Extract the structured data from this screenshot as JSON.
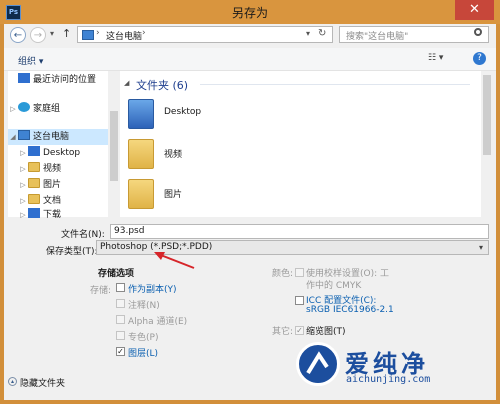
{
  "window": {
    "app_icon": "Ps",
    "title": "另存为",
    "close_glyph": "✕"
  },
  "address": {
    "back_glyph": "←",
    "forward_glyph": "→",
    "recent_glyph": "▾",
    "up_glyph": "↑",
    "path_sep": "›",
    "location": "这台电脑",
    "refresh_glyph": "↻",
    "search_placeholder": "搜索\"这台电脑\""
  },
  "toolbar": {
    "organize_label": "组织 ▾",
    "view_glyph": "☷ ▾",
    "help_glyph": "?"
  },
  "nav": {
    "items": [
      {
        "label": "最近访问的位置"
      },
      {
        "label": "家庭组"
      },
      {
        "label": "这台电脑"
      },
      {
        "label": "Desktop"
      },
      {
        "label": "视频"
      },
      {
        "label": "图片"
      },
      {
        "label": "文档"
      },
      {
        "label": "下载"
      }
    ]
  },
  "files": {
    "group_header": "文件夹 (6)",
    "items": [
      {
        "name": "Desktop"
      },
      {
        "name": "视频"
      },
      {
        "name": "图片"
      }
    ]
  },
  "form": {
    "filename_label": "文件名(N):",
    "filename_value": "93.psd",
    "filetype_label": "保存类型(T):",
    "filetype_value": "Photoshop (*.PSD;*.PDD)",
    "dropdown_glyph": "▾"
  },
  "options": {
    "save_options_title": "存储选项",
    "store_label": "存储:",
    "as_copy": "作为副本(Y)",
    "notes": "注释(N)",
    "alpha": "Alpha 通道(E)",
    "spot": "专色(P)",
    "layers": "图层(L)",
    "color_label": "颜色:",
    "proof_setup": "使用校样设置(O): 工作中的 CMYK",
    "proof_line1": "使用校样设置(O): 工",
    "proof_line2": "作中的 CMYK",
    "icc_line1": "ICC 配置文件(C):",
    "icc_line2": "sRGB IEC61966-2.1",
    "other_label": "其它:",
    "thumbnail": "缩览图(T)"
  },
  "footer": {
    "hide_folders": "隐藏文件夹"
  },
  "watermark": {
    "text": "爱纯净",
    "url": "aichunjing.com"
  },
  "colors": {
    "titlebar": "#d9953e",
    "close": "#c7473a",
    "selection": "#cce8ff",
    "arrow": "#d6252a"
  }
}
